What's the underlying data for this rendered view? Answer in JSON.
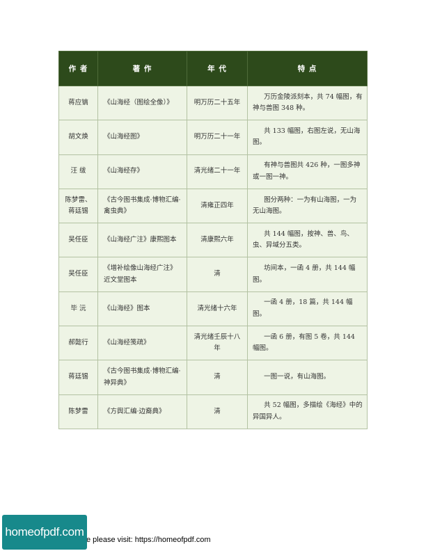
{
  "table": {
    "headers": [
      "作 者",
      "著 作",
      "年 代",
      "特 点"
    ],
    "rows": [
      {
        "author": "蒋应镐",
        "work": "《山海经（图绘全像）》",
        "era": "明万历二十五年",
        "features": "万历金陵派刻本，共 74 幅图，有神与兽图 348 种。"
      },
      {
        "author": "胡文焕",
        "work": "《山海经图》",
        "era": "明万历二十一年",
        "features": "共 133 幅图，右图左说，无山海图。"
      },
      {
        "author": "汪 绂",
        "work": "《山海经存》",
        "era": "清光绪二十一年",
        "features": "有神与兽图共 426 种，一图多神或一图一神。"
      },
      {
        "author": "陈梦雷、蒋廷锡",
        "work": "《古今图书集成·博物汇编·禽虫典》",
        "era": "清雍正四年",
        "features": "图分两种：一为有山海图，一为无山海图。"
      },
      {
        "author": "吴任臣",
        "work": "《山海经广注》康熙图本",
        "era": "清康熙六年",
        "features": "共 144 幅图，按神、兽、鸟、虫、异域分五类。"
      },
      {
        "author": "吴任臣",
        "work": "《增补绘像山海经广注》近文堂图本",
        "era": "清",
        "features": "坊间本，一函 4 册，共 144 幅图。"
      },
      {
        "author": "毕 沅",
        "work": "《山海经》图本",
        "era": "清光绪十六年",
        "features": "一函 4 册，18 篇，共 144 幅图。"
      },
      {
        "author": "郝懿行",
        "work": "《山海经笺疏》",
        "era": "清光绪壬辰十八年",
        "features": "一函 6 册，有图 5 卷，共 144 幅图。"
      },
      {
        "author": "蒋廷锡",
        "work": "《古今图书集成·博物汇编·神异典》",
        "era": "清",
        "features": "一图一说，有山海图。"
      },
      {
        "author": "陈梦雷",
        "work": "《方舆汇编·边裔典》",
        "era": "清",
        "features": "共 52 幅图，多描绘《海经》中的异国异人。"
      }
    ]
  },
  "footer": {
    "logo_text": "homeofpdf.com",
    "visit_text": "e please visit: https://homeofpdf.com"
  },
  "colors": {
    "header_bg": "#2d4a1b",
    "cell_bg": "#eef4e5",
    "border": "#b3c2a2",
    "logo_bg": "#17898b"
  }
}
